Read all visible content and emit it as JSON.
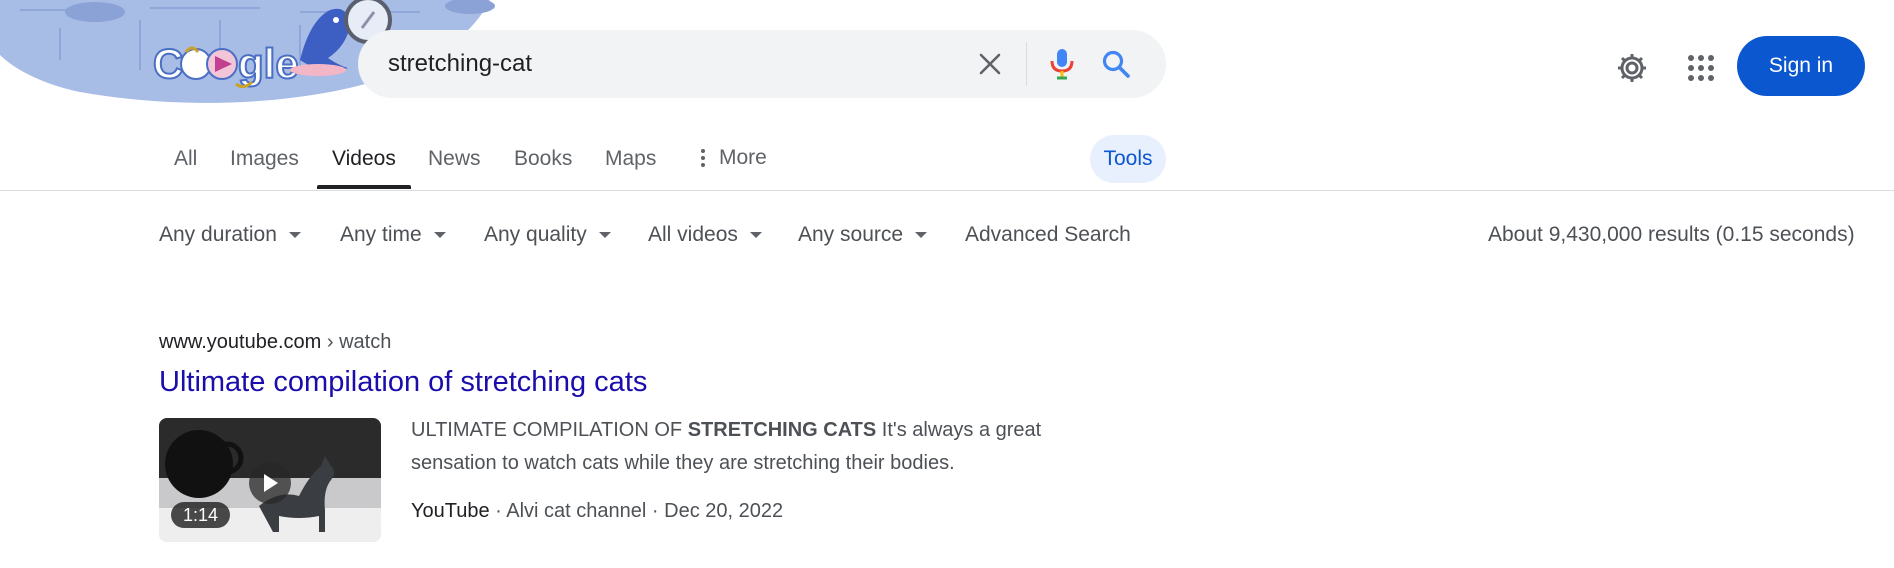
{
  "search": {
    "query": "stretching-cat"
  },
  "header": {
    "sign_in_label": "Sign in"
  },
  "tabs": [
    {
      "label": "All"
    },
    {
      "label": "Images"
    },
    {
      "label": "Videos",
      "active": true
    },
    {
      "label": "News"
    },
    {
      "label": "Books"
    },
    {
      "label": "Maps"
    },
    {
      "label": "More"
    }
  ],
  "tools_label": "Tools",
  "filters": [
    {
      "label": "Any duration"
    },
    {
      "label": "Any time"
    },
    {
      "label": "Any quality"
    },
    {
      "label": "All videos"
    },
    {
      "label": "Any source"
    }
  ],
  "advanced_search_label": "Advanced Search",
  "result_stats": "About 9,430,000 results (0.15 seconds)",
  "results": [
    {
      "domain": "www.youtube.com",
      "crumb": "› watch",
      "title": "Ultimate compilation of stretching cats",
      "snippet_pre": "ULTIMATE COMPILATION OF ",
      "snippet_bold": "STRETCHING CATS",
      "snippet_post": " It's always a great sensation to watch cats while they are stretching their bodies.",
      "source": "YouTube",
      "channel": "· Alvi cat channel",
      "date": "· Dec 20, 2022",
      "duration": "1:14"
    }
  ],
  "colors": {
    "link": "#1a0dab",
    "accent": "#0b57d0",
    "tools_bg": "#e8f0fe"
  }
}
